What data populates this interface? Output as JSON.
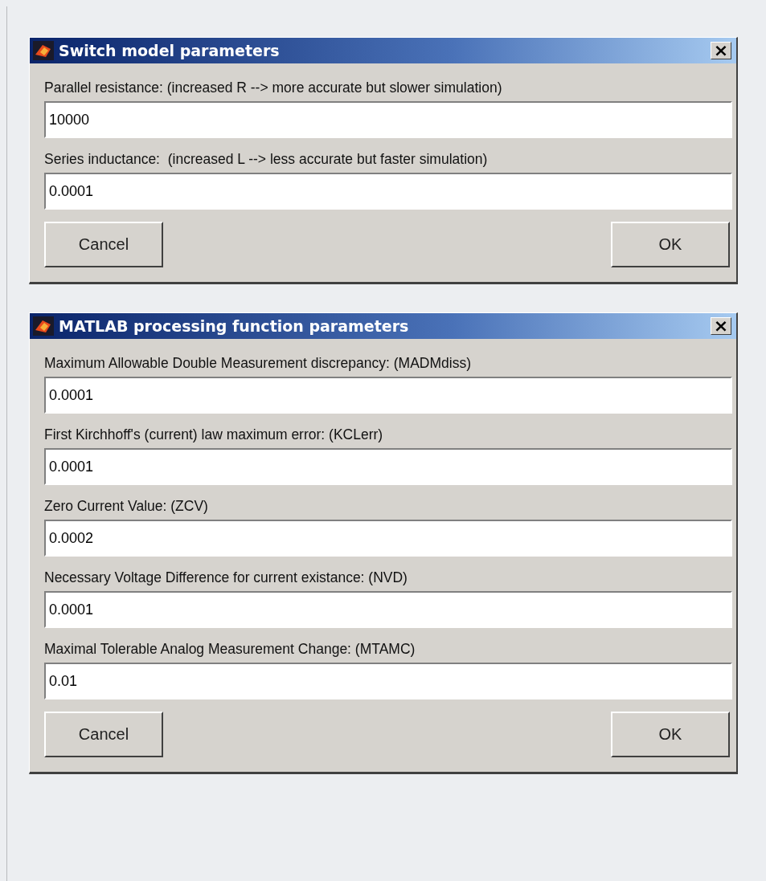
{
  "dialogs": [
    {
      "title": "Switch model parameters",
      "close": "×",
      "fields": [
        {
          "label": "Parallel resistance: (increased R --> more accurate but slower simulation)",
          "value": "10000"
        },
        {
          "label": "Series inductance:  (increased L --> less accurate but faster simulation)",
          "value": "0.0001"
        }
      ],
      "buttons": [
        "Cancel",
        "OK"
      ]
    },
    {
      "title": "MATLAB processing function parameters",
      "close": "×",
      "fields": [
        {
          "label": "Maximum Allowable Double Measurement discrepancy: (MADMdiss)",
          "value": "0.0001"
        },
        {
          "label": "First Kirchhoff's (current) law maximum error: (KCLerr)",
          "value": "0.0001"
        },
        {
          "label": "Zero Current Value: (ZCV)",
          "value": "0.0002"
        },
        {
          "label": "Necessary Voltage Difference for current existance: (NVD)",
          "value": "0.0001"
        },
        {
          "label": "Maximal Tolerable Analog Measurement Change: (MTAMC)",
          "value": "0.01"
        }
      ],
      "buttons": [
        "Cancel",
        "OK"
      ]
    }
  ]
}
